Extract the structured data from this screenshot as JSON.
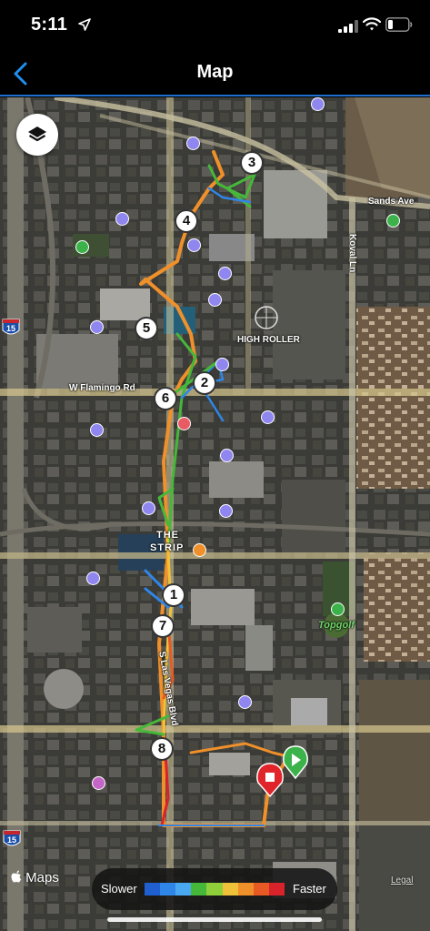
{
  "status_bar": {
    "time": "5:11"
  },
  "nav": {
    "title": "Map"
  },
  "map": {
    "labels": {
      "sands_ave": "Sands Ave",
      "koval_ln": "Koval Ln",
      "high_roller": "HIGH ROLLER",
      "w_flamingo": "W Flamingo Rd",
      "the_strip_1": "THE",
      "the_strip_2": "STRIP",
      "topgolf": "Topgolf",
      "s_las_vegas_blvd": "S Las Vegas Blvd",
      "interstate_a": "15",
      "interstate_b": "15"
    },
    "markers": [
      "1",
      "2",
      "3",
      "4",
      "5",
      "6",
      "7",
      "8"
    ],
    "apple_maps": "Maps",
    "legal": "Legal"
  },
  "legend": {
    "slower": "Slower",
    "faster": "Faster",
    "colors": [
      "#1f5fd0",
      "#2f86e8",
      "#4aa8f0",
      "#45b83a",
      "#8fcf3a",
      "#f0c23a",
      "#f0902a",
      "#e85a24",
      "#d8232a"
    ]
  },
  "colors": {
    "accent": "#1f8ff0",
    "start": "#3cb34a",
    "end": "#e0242a"
  }
}
